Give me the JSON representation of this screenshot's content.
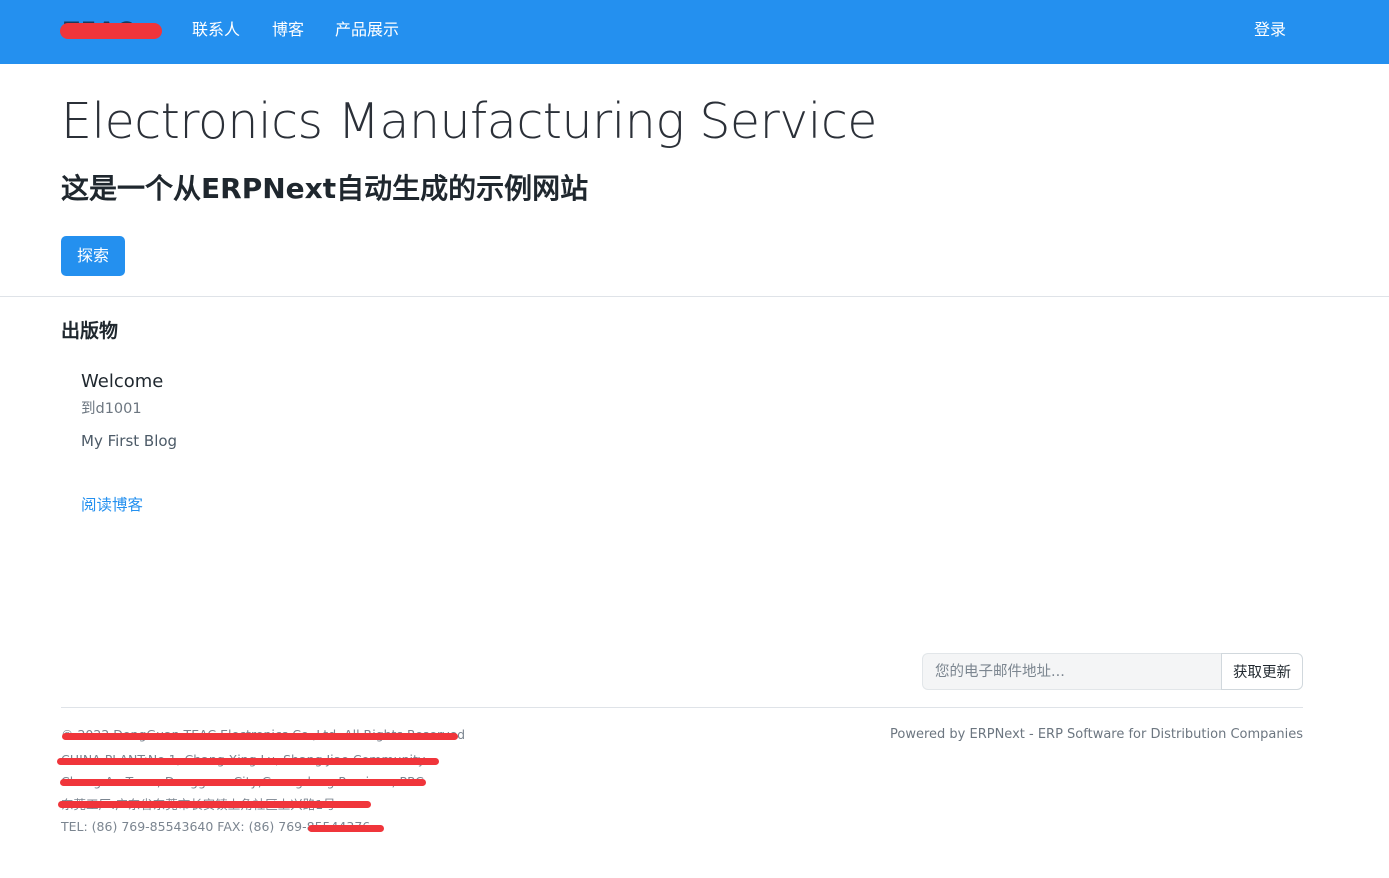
{
  "navbar": {
    "brand_label": "TEAC",
    "links": [
      {
        "label": "联系人"
      },
      {
        "label": "博客"
      },
      {
        "label": "产品展示"
      }
    ],
    "login_label": "登录"
  },
  "hero": {
    "title": "Electronics Manufacturing Service",
    "subtitle": "这是一个从ERPNext自动生成的示例网站",
    "explore_button": "探索"
  },
  "publications": {
    "section_title": "出版物",
    "post": {
      "title": "Welcome",
      "meta": "到d1001",
      "description": "My First Blog",
      "read_link": "阅读博客"
    }
  },
  "subscribe": {
    "placeholder": "您的电子邮件地址...",
    "button_label": "获取更新"
  },
  "footer": {
    "lines": [
      "© 2022 DongGuan TEAC Electronics Co.,Ltd. All Rights Reserved",
      "CHINA PLANT:No.1, Chang Xing Lu, Shang Jiao Community",
      "Chang An Town, Dongguan City,Guangdong Province, PRC",
      "东莞工厂:广东省东莞市长安镇上角社区上兴路1号",
      "TEL: (86) 769-85543640  FAX: (86) 769-85544376"
    ],
    "powered_by": "Powered by ERPNext - ERP Software for Distribution Companies"
  },
  "colors": {
    "primary": "#2490ef",
    "redaction": "#f0353b"
  }
}
